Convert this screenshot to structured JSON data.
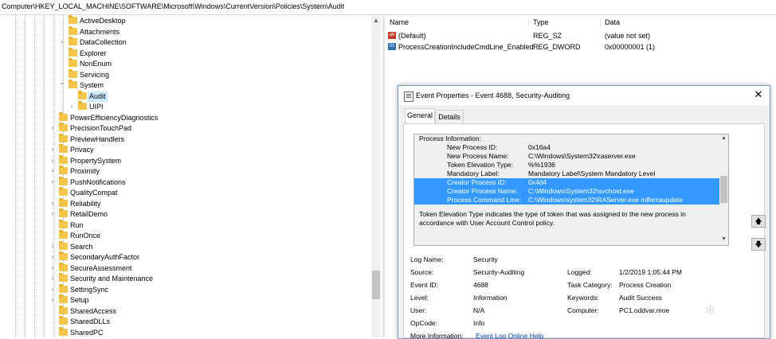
{
  "address_bar": {
    "path": "Computer\\HKEY_LOCAL_MACHINE\\SOFTWARE\\Microsoft\\Windows\\CurrentVersion\\Policies\\System\\Audit"
  },
  "tree": {
    "items": [
      {
        "label": "ActiveDesktop",
        "level": 1,
        "expander": ""
      },
      {
        "label": "Attachments",
        "level": 1,
        "expander": ""
      },
      {
        "label": "DataCollection",
        "level": 1,
        "expander": ">"
      },
      {
        "label": "Explorer",
        "level": 1,
        "expander": ""
      },
      {
        "label": "NonEnum",
        "level": 1,
        "expander": ""
      },
      {
        "label": "Servicing",
        "level": 1,
        "expander": ""
      },
      {
        "label": "System",
        "level": 1,
        "expander": "v"
      },
      {
        "label": "Audit",
        "level": 2,
        "expander": "",
        "selected": true
      },
      {
        "label": "UIPI",
        "level": 2,
        "expander": ">"
      },
      {
        "label": "PowerEfficiencyDiagnostics",
        "level": 0,
        "expander": ""
      },
      {
        "label": "PrecisionTouchPad",
        "level": 0,
        "expander": ">"
      },
      {
        "label": "PreviewHandlers",
        "level": 0,
        "expander": ""
      },
      {
        "label": "Privacy",
        "level": 0,
        "expander": ">"
      },
      {
        "label": "PropertySystem",
        "level": 0,
        "expander": ">"
      },
      {
        "label": "Proximity",
        "level": 0,
        "expander": ">"
      },
      {
        "label": "PushNotifications",
        "level": 0,
        "expander": ">"
      },
      {
        "label": "QualityCompat",
        "level": 0,
        "expander": ""
      },
      {
        "label": "Reliability",
        "level": 0,
        "expander": ">"
      },
      {
        "label": "RetailDemo",
        "level": 0,
        "expander": ">"
      },
      {
        "label": "Run",
        "level": 0,
        "expander": ""
      },
      {
        "label": "RunOnce",
        "level": 0,
        "expander": ""
      },
      {
        "label": "Search",
        "level": 0,
        "expander": ">"
      },
      {
        "label": "SecondaryAuthFactor",
        "level": 0,
        "expander": ">"
      },
      {
        "label": "SecureAssessment",
        "level": 0,
        "expander": ">"
      },
      {
        "label": "Security and Maintenance",
        "level": 0,
        "expander": ">"
      },
      {
        "label": "SettingSync",
        "level": 0,
        "expander": ">"
      },
      {
        "label": "Setup",
        "level": 0,
        "expander": ">"
      },
      {
        "label": "SharedAccess",
        "level": 0,
        "expander": ""
      },
      {
        "label": "SharedDLLs",
        "level": 0,
        "expander": ""
      },
      {
        "label": "SharedPC",
        "level": 0,
        "expander": ""
      }
    ]
  },
  "values_list": {
    "headers": {
      "name": "Name",
      "type": "Type",
      "data": "Data"
    },
    "rows": [
      {
        "icon": "string-value-icon",
        "name": "(Default)",
        "type": "REG_SZ",
        "data": "(value not set)"
      },
      {
        "icon": "dword-value-icon",
        "name": "ProcessCreationIncludeCmdLine_Enabled",
        "type": "REG_DWORD",
        "data": "0x00000001 (1)"
      }
    ]
  },
  "dialog": {
    "title": "Event Properties - Event 4688, Security-Auditing",
    "tabs": [
      "General",
      "Details"
    ],
    "description": {
      "heading": "Process Information:",
      "fields": [
        {
          "key": "New Process ID:",
          "value": "0x16a4",
          "highlight": false
        },
        {
          "key": "New Process Name:",
          "value": "C:\\Windows\\System32\\raserver.exe",
          "highlight": false
        },
        {
          "key": "Token Elevation Type:",
          "value": "%%1936",
          "highlight": false
        },
        {
          "key": "Mandatory Label:",
          "value": "Mandatory Label\\System Mandatory Level",
          "highlight": false
        },
        {
          "key": "Creator Process ID:",
          "value": "0x4d4",
          "highlight": true
        },
        {
          "key": "Creator Process Name:",
          "value": "C:\\Windows\\System32\\svchost.exe",
          "highlight": true
        },
        {
          "key": "Process Command Line:",
          "value": "C:\\Windows\\system32\\RAServer.exe /offerraupdate",
          "highlight": true
        }
      ],
      "paragraph_1": "Token Elevation Type indicates the type of token that was assigned to the new process in",
      "paragraph_2": "accordance with User Account Control policy."
    },
    "info": {
      "log_name_label": "Log Name:",
      "log_name": "Security",
      "source_label": "Source:",
      "source": "Security-Auditing",
      "logged_label": "Logged:",
      "logged": "1/2/2019 1:05:44 PM",
      "event_id_label": "Event ID:",
      "event_id": "4688",
      "task_category_label": "Task Category:",
      "task_category": "Process Creation",
      "level_label": "Level:",
      "level": "Information",
      "keywords_label": "Keywords:",
      "keywords": "Audit Success",
      "user_label": "User:",
      "user": "N/A",
      "computer_label": "Computer:",
      "computer": "PC1.oddvar.moe",
      "opcode_label": "OpCode:",
      "opcode": "Info",
      "more_info_label": "More Information:",
      "more_info_link": "Event Log Online Help"
    }
  },
  "colors": {
    "selection": "#3399ff",
    "tree_selection": "#cce8ff",
    "folder": "#f3c54a",
    "link": "#0645ad"
  }
}
